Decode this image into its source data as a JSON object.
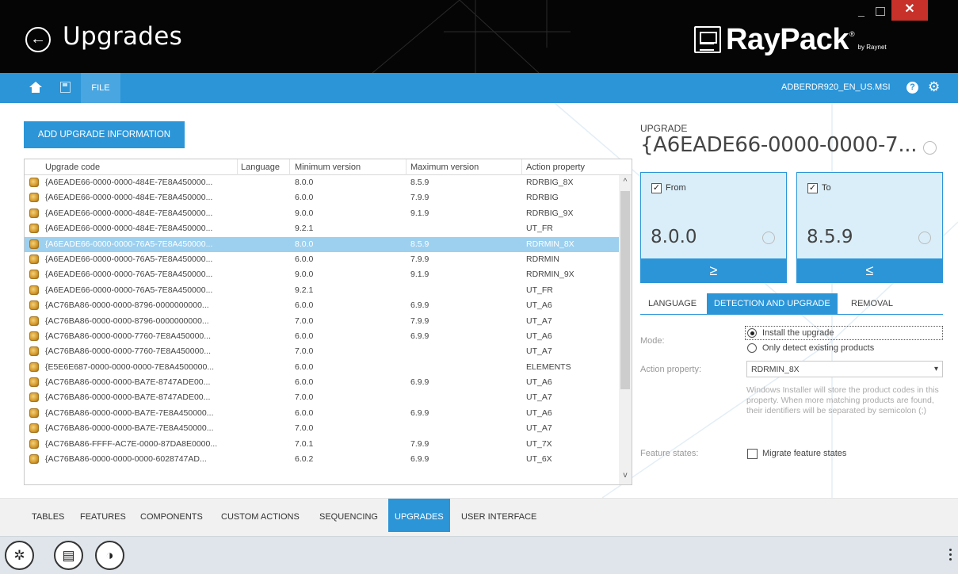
{
  "window": {
    "title": "Upgrades",
    "brand": "RayPack",
    "brand_reg": "®",
    "brand_by": "by Raynet",
    "minimize": "_",
    "close": "✕"
  },
  "ribbon": {
    "file_tab": "FILE",
    "filename": "ADBERDR920_EN_US.MSI",
    "help": "?"
  },
  "main": {
    "add_button": "ADD UPGRADE INFORMATION",
    "columns": [
      "Upgrade code",
      "Language",
      "Minimum version",
      "Maximum version",
      "Action property"
    ],
    "rows": [
      {
        "code": "{A6EADE66-0000-0000-484E-7E8A450000...",
        "lang": "",
        "min": "8.0.0",
        "max": "8.5.9",
        "prop": "RDRBIG_8X"
      },
      {
        "code": "{A6EADE66-0000-0000-484E-7E8A450000...",
        "lang": "",
        "min": "6.0.0",
        "max": "7.9.9",
        "prop": "RDRBIG"
      },
      {
        "code": "{A6EADE66-0000-0000-484E-7E8A450000...",
        "lang": "",
        "min": "9.0.0",
        "max": "9.1.9",
        "prop": "RDRBIG_9X"
      },
      {
        "code": "{A6EADE66-0000-0000-484E-7E8A450000...",
        "lang": "",
        "min": "9.2.1",
        "max": "",
        "prop": "UT_FR"
      },
      {
        "code": "{A6EADE66-0000-0000-76A5-7E8A450000...",
        "lang": "",
        "min": "8.0.0",
        "max": "8.5.9",
        "prop": "RDRMIN_8X"
      },
      {
        "code": "{A6EADE66-0000-0000-76A5-7E8A450000...",
        "lang": "",
        "min": "6.0.0",
        "max": "7.9.9",
        "prop": "RDRMIN"
      },
      {
        "code": "{A6EADE66-0000-0000-76A5-7E8A450000...",
        "lang": "",
        "min": "9.0.0",
        "max": "9.1.9",
        "prop": "RDRMIN_9X"
      },
      {
        "code": "{A6EADE66-0000-0000-76A5-7E8A450000...",
        "lang": "",
        "min": "9.2.1",
        "max": "",
        "prop": "UT_FR"
      },
      {
        "code": "{AC76BA86-0000-0000-8796-0000000000...",
        "lang": "",
        "min": "6.0.0",
        "max": "6.9.9",
        "prop": "UT_A6"
      },
      {
        "code": "{AC76BA86-0000-0000-8796-0000000000...",
        "lang": "",
        "min": "7.0.0",
        "max": "7.9.9",
        "prop": "UT_A7"
      },
      {
        "code": "{AC76BA86-0000-0000-7760-7E8A450000...",
        "lang": "",
        "min": "6.0.0",
        "max": "6.9.9",
        "prop": "UT_A6"
      },
      {
        "code": "{AC76BA86-0000-0000-7760-7E8A450000...",
        "lang": "",
        "min": "7.0.0",
        "max": "",
        "prop": "UT_A7"
      },
      {
        "code": "{E5E6E687-0000-0000-0000-7E8A4500000...",
        "lang": "",
        "min": "6.0.0",
        "max": "",
        "prop": "ELEMENTS"
      },
      {
        "code": "{AC76BA86-0000-0000-BA7E-8747ADE00...",
        "lang": "",
        "min": "6.0.0",
        "max": "6.9.9",
        "prop": "UT_A6"
      },
      {
        "code": "{AC76BA86-0000-0000-BA7E-8747ADE00...",
        "lang": "",
        "min": "7.0.0",
        "max": "",
        "prop": "UT_A7"
      },
      {
        "code": "{AC76BA86-0000-0000-BA7E-7E8A450000...",
        "lang": "",
        "min": "6.0.0",
        "max": "6.9.9",
        "prop": "UT_A6"
      },
      {
        "code": "{AC76BA86-0000-0000-BA7E-7E8A450000...",
        "lang": "",
        "min": "7.0.0",
        "max": "",
        "prop": "UT_A7"
      },
      {
        "code": "{AC76BA86-FFFF-AC7E-0000-87DA8E0000...",
        "lang": "",
        "min": "7.0.1",
        "max": "7.9.9",
        "prop": "UT_7X"
      },
      {
        "code": "{AC76BA86-0000-0000-0000-6028747AD...",
        "lang": "",
        "min": "6.0.2",
        "max": "6.9.9",
        "prop": "UT_6X"
      }
    ],
    "selected_index": 4,
    "scroll_up": "^",
    "scroll_down": "v"
  },
  "detail": {
    "heading": "UPGRADE",
    "value": "{A6EADE66-0000-0000-7...",
    "from": {
      "label": "From",
      "checked": "✓",
      "version": "8.0.0",
      "operator": "≥"
    },
    "to": {
      "label": "To",
      "checked": "✓",
      "version": "8.5.9",
      "operator": "≤"
    },
    "tabs": [
      "LANGUAGE",
      "DETECTION AND UPGRADE",
      "REMOVAL"
    ],
    "active_tab": 1,
    "mode_label": "Mode:",
    "mode_options": [
      "Install the upgrade",
      "Only detect existing products"
    ],
    "action_label": "Action property:",
    "action_value": "RDRMIN_8X",
    "action_description": "Windows Installer will store the product codes in this property. When more matching products are found, their identifiers will be separated by semicolon (;)",
    "feature_label": "Feature states:",
    "migrate_label": "Migrate feature states"
  },
  "bottom_tabs": [
    "TABLES",
    "FEATURES",
    "COMPONENTS",
    "CUSTOM ACTIONS",
    "SEQUENCING",
    "UPGRADES",
    "USER INTERFACE"
  ],
  "bottom_active": 5,
  "colors": {
    "accent": "#2b95d8",
    "selected_row": "#9dd0ef",
    "close": "#c7312a",
    "titlebar": "#050505"
  },
  "icons": {
    "back": "arrow-left-circle-icon",
    "home": "home-icon",
    "save": "save-icon",
    "help": "help-icon",
    "settings": "gear-icon",
    "wizard": "wand-icon",
    "tables": "table-icon",
    "package": "package-icon"
  }
}
